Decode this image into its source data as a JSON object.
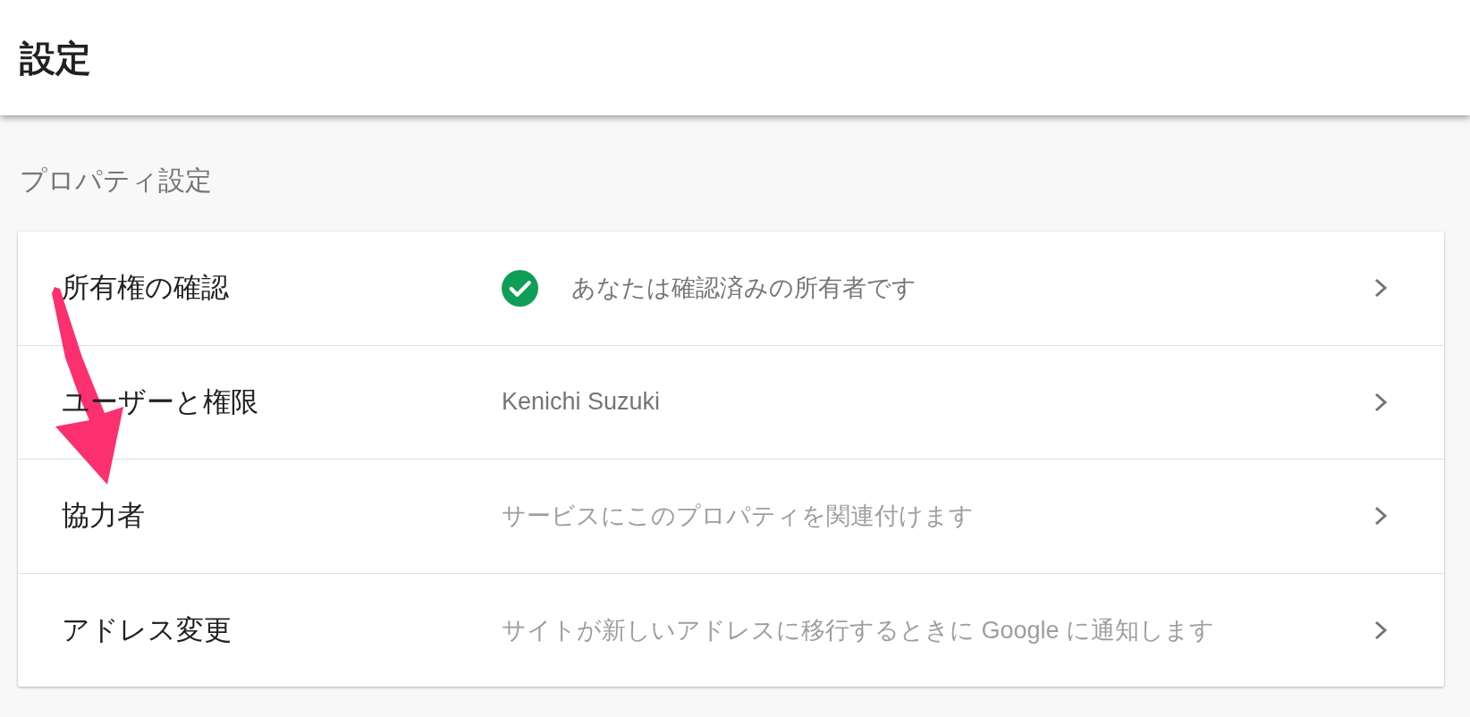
{
  "header": {
    "title": "設定"
  },
  "section": {
    "title": "プロパティ設定"
  },
  "settings": [
    {
      "label": "所有権の確認",
      "kind": "status",
      "value": "あなたは確認済みの所有者です"
    },
    {
      "label": "ユーザーと権限",
      "kind": "value",
      "value": "Kenichi Suzuki"
    },
    {
      "label": "協力者",
      "kind": "description",
      "value": "サービスにこのプロパティを関連付けます"
    },
    {
      "label": "アドレス変更",
      "kind": "description",
      "value": "サイトが新しいアドレスに移行するときに Google に通知します"
    }
  ],
  "annotation": {
    "kind": "arrow"
  }
}
